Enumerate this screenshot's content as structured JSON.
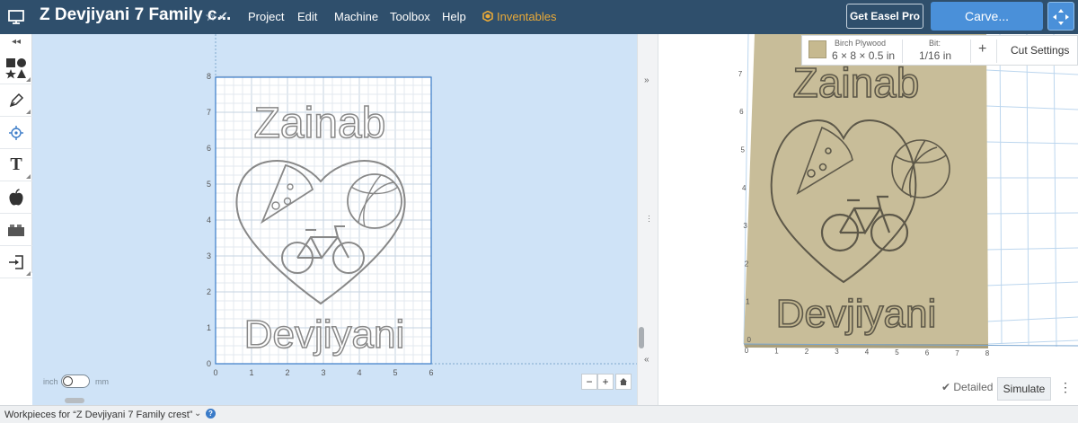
{
  "header": {
    "title": "Z Devjiyani 7 Family c...",
    "menu": [
      "Project",
      "Edit",
      "Machine",
      "Toolbox",
      "Help"
    ],
    "inventables": "Inventables",
    "get_pro": "Get Easel Pro",
    "carve": "Carve..."
  },
  "toolbar": {
    "items": [
      "shapes-icon",
      "pen-icon",
      "target-icon",
      "text-icon",
      "apple-icon",
      "bricks-icon",
      "import-icon"
    ]
  },
  "design": {
    "x_ticks": [
      "0",
      "1",
      "2",
      "3",
      "4",
      "5",
      "6"
    ],
    "y_ticks": [
      "0",
      "1",
      "2",
      "3",
      "4",
      "5",
      "6",
      "7",
      "8"
    ],
    "text_top": "Zainab",
    "text_bottom": "Devjiyani",
    "unit_left": "inch",
    "unit_right": "mm"
  },
  "material": {
    "name": "Birch Plywood",
    "dimensions": "6 × 8 × 0.5 in",
    "bit_label": "Bit:",
    "bit_value": "1/16 in",
    "cut_settings": "Cut Settings",
    "color": "#c6b98f"
  },
  "preview": {
    "y_ticks": [
      "0",
      "1",
      "2",
      "3",
      "4",
      "5",
      "6",
      "7"
    ],
    "x_ticks": [
      "0",
      "1",
      "2",
      "3",
      "4",
      "5",
      "6",
      "7",
      "8"
    ],
    "text_top": "Zainab",
    "text_bottom": "Devjiyani",
    "detailed": "Detailed",
    "simulate": "Simulate"
  },
  "status": {
    "workpieces": "Workpieces for “Z Devjiyani 7 Family crest”"
  },
  "colors": {
    "header": "#2f4f6c",
    "accent": "#4a90d9",
    "inventables": "#e8a938",
    "canvas": "#cfe3f7"
  }
}
